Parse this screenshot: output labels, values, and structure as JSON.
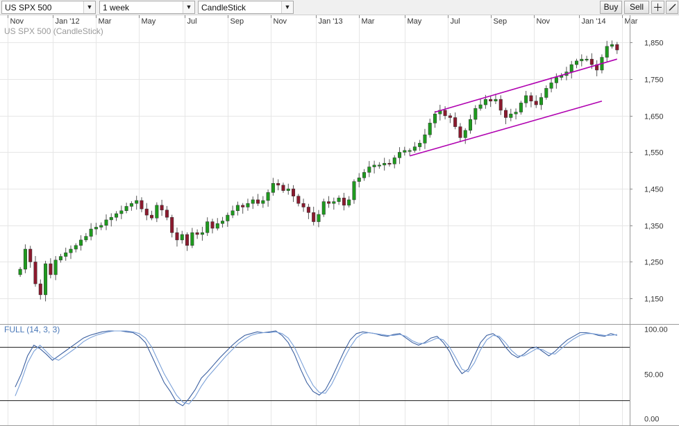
{
  "toolbar": {
    "symbol": "US SPX 500",
    "timeframe": "1 week",
    "chart_type": "CandleStick",
    "buy_label": "Buy",
    "sell_label": "Sell"
  },
  "colors": {
    "up": "#1e9a1e",
    "down": "#8b1a2e",
    "channel": "#b000b0",
    "osc_main": "#3a5fa0",
    "osc_signal": "#7aa0d8"
  },
  "icons": {
    "dropdown": "chevron-down-icon",
    "crosshair": "crosshair-icon",
    "pencil": "pencil-icon"
  },
  "chart_data": [
    {
      "type": "candlestick",
      "title": "US SPX 500 (CandleStick)",
      "x_ticks": [
        "Nov",
        "Jan '12",
        "Mar",
        "May",
        "Jul",
        "Sep",
        "Nov",
        "Jan '13",
        "Mar",
        "May",
        "Jul",
        "Sep",
        "Nov",
        "Jan '14",
        "Mar"
      ],
      "y_ticks": [
        "1,850",
        "1,750",
        "1,650",
        "1,550",
        "1,450",
        "1,350",
        "1,250",
        "1,150"
      ],
      "y_tick_values": [
        1850,
        1750,
        1650,
        1550,
        1450,
        1350,
        1250,
        1150
      ],
      "ylim": [
        1080,
        1925
      ],
      "x_range_weeks": [
        -4,
        118
      ],
      "grid": true,
      "anchor_closes": [
        [
          0,
          1230
        ],
        [
          1,
          1285
        ],
        [
          2,
          1250
        ],
        [
          3,
          1190
        ],
        [
          4,
          1160
        ],
        [
          5,
          1245
        ],
        [
          6,
          1215
        ],
        [
          7,
          1255
        ],
        [
          8,
          1265
        ],
        [
          9,
          1275
        ],
        [
          10,
          1285
        ],
        [
          11,
          1295
        ],
        [
          12,
          1310
        ],
        [
          13,
          1320
        ],
        [
          14,
          1340
        ],
        [
          15,
          1345
        ],
        [
          16,
          1350
        ],
        [
          17,
          1365
        ],
        [
          18,
          1372
        ],
        [
          19,
          1382
        ],
        [
          20,
          1390
        ],
        [
          21,
          1402
        ],
        [
          22,
          1410
        ],
        [
          23,
          1418
        ],
        [
          24,
          1395
        ],
        [
          25,
          1378
        ],
        [
          26,
          1370
        ],
        [
          27,
          1405
        ],
        [
          28,
          1392
        ],
        [
          29,
          1372
        ],
        [
          30,
          1330
        ],
        [
          31,
          1310
        ],
        [
          32,
          1325
        ],
        [
          33,
          1295
        ],
        [
          34,
          1330
        ],
        [
          35,
          1325
        ],
        [
          36,
          1330
        ],
        [
          37,
          1360
        ],
        [
          38,
          1342
        ],
        [
          39,
          1355
        ],
        [
          40,
          1362
        ],
        [
          41,
          1378
        ],
        [
          42,
          1390
        ],
        [
          43,
          1405
        ],
        [
          44,
          1400
        ],
        [
          45,
          1410
        ],
        [
          46,
          1420
        ],
        [
          47,
          1410
        ],
        [
          48,
          1418
        ],
        [
          49,
          1440
        ],
        [
          50,
          1465
        ],
        [
          51,
          1460
        ],
        [
          52,
          1445
        ],
        [
          53,
          1450
        ],
        [
          54,
          1430
        ],
        [
          55,
          1410
        ],
        [
          56,
          1400
        ],
        [
          57,
          1385
        ],
        [
          58,
          1360
        ],
        [
          59,
          1380
        ],
        [
          60,
          1415
        ],
        [
          61,
          1410
        ],
        [
          62,
          1415
        ],
        [
          63,
          1425
        ],
        [
          64,
          1405
        ],
        [
          65,
          1420
        ],
        [
          66,
          1470
        ],
        [
          67,
          1480
        ],
        [
          68,
          1495
        ],
        [
          69,
          1510
        ],
        [
          70,
          1515
        ],
        [
          71,
          1515
        ],
        [
          72,
          1520
        ],
        [
          73,
          1518
        ],
        [
          74,
          1535
        ],
        [
          75,
          1550
        ],
        [
          76,
          1555
        ],
        [
          77,
          1555
        ],
        [
          78,
          1565
        ],
        [
          79,
          1575
        ],
        [
          80,
          1598
        ],
        [
          81,
          1630
        ],
        [
          82,
          1655
        ],
        [
          83,
          1665
        ],
        [
          84,
          1650
        ],
        [
          85,
          1645
        ],
        [
          86,
          1620
        ],
        [
          87,
          1590
        ],
        [
          88,
          1610
        ],
        [
          89,
          1640
        ],
        [
          90,
          1670
        ],
        [
          91,
          1680
        ],
        [
          92,
          1695
        ],
        [
          93,
          1690
        ],
        [
          94,
          1695
        ],
        [
          95,
          1665
        ],
        [
          96,
          1645
        ],
        [
          97,
          1655
        ],
        [
          98,
          1660
        ],
        [
          99,
          1685
        ],
        [
          100,
          1705
        ],
        [
          101,
          1690
        ],
        [
          102,
          1680
        ],
        [
          103,
          1700
        ],
        [
          104,
          1725
        ],
        [
          105,
          1740
        ],
        [
          106,
          1755
        ],
        [
          107,
          1760
        ],
        [
          108,
          1770
        ],
        [
          109,
          1790
        ],
        [
          110,
          1800
        ],
        [
          111,
          1805
        ],
        [
          112,
          1805
        ],
        [
          113,
          1790
        ],
        [
          114,
          1775
        ],
        [
          115,
          1810
        ],
        [
          116,
          1840
        ],
        [
          117,
          1845
        ],
        [
          118,
          1830
        ]
      ],
      "channel_lines": [
        {
          "name": "upper-channel",
          "from": [
            82,
            1660
          ],
          "to": [
            118,
            1805
          ]
        },
        {
          "name": "lower-channel",
          "from": [
            77,
            1540
          ],
          "to": [
            115,
            1690
          ]
        }
      ]
    },
    {
      "type": "line",
      "title": "FULL (14, 3, 3)",
      "y_ticks": [
        "100.00",
        "50.00",
        "0.00"
      ],
      "y_tick_values": [
        100,
        50,
        0
      ],
      "ylim": [
        -8,
        105
      ],
      "hlines": [
        80,
        20
      ],
      "series": [
        {
          "values": [
            35,
            50,
            70,
            82,
            78,
            72,
            65,
            70,
            75,
            80,
            85,
            90,
            93,
            95,
            97,
            98,
            98,
            98,
            97,
            96,
            92,
            85,
            70,
            55,
            40,
            30,
            18,
            14,
            22,
            32,
            45,
            52,
            60,
            68,
            75,
            82,
            88,
            93,
            95,
            97,
            96,
            97,
            98,
            93,
            85,
            72,
            55,
            40,
            30,
            26,
            32,
            45,
            60,
            75,
            88,
            95,
            97,
            96,
            95,
            93,
            92,
            94,
            95,
            90,
            85,
            82,
            85,
            90,
            92,
            85,
            75,
            60,
            50,
            55,
            70,
            85,
            93,
            95,
            90,
            80,
            72,
            68,
            72,
            78,
            80,
            75,
            70,
            75,
            82,
            88,
            92,
            96,
            96,
            95,
            93,
            92,
            95,
            93
          ]
        },
        {
          "values": [
            25,
            42,
            62,
            75,
            82,
            75,
            68,
            65,
            70,
            75,
            80,
            86,
            90,
            93,
            95,
            97,
            98,
            98,
            98,
            97,
            95,
            90,
            80,
            65,
            50,
            38,
            26,
            18,
            16,
            24,
            36,
            46,
            54,
            62,
            70,
            77,
            84,
            89,
            93,
            95,
            96,
            96,
            97,
            95,
            90,
            80,
            65,
            50,
            37,
            29,
            28,
            38,
            52,
            67,
            80,
            90,
            95,
            96,
            95,
            94,
            93,
            93,
            94,
            92,
            87,
            84,
            84,
            87,
            90,
            88,
            80,
            68,
            55,
            52,
            62,
            77,
            88,
            93,
            92,
            85,
            76,
            70,
            70,
            74,
            78,
            77,
            73,
            72,
            78,
            84,
            89,
            93,
            95,
            95,
            94,
            93,
            93,
            94
          ]
        }
      ]
    }
  ]
}
